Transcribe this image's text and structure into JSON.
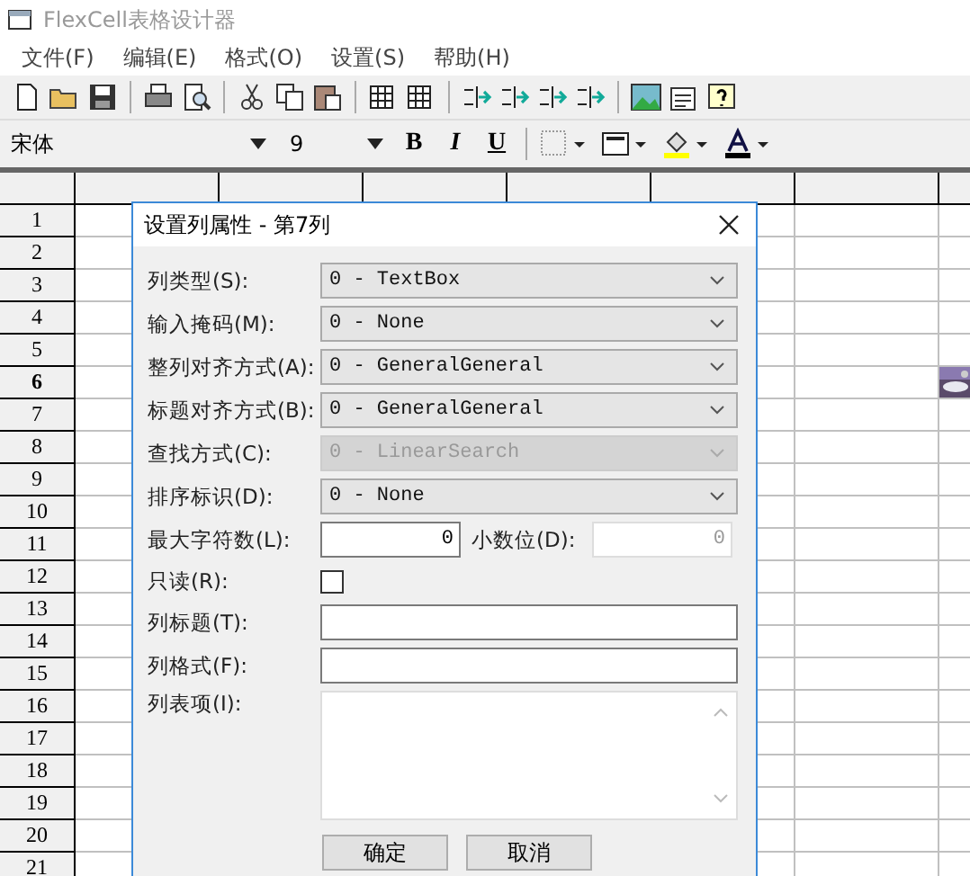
{
  "window": {
    "title": "FlexCell表格设计器"
  },
  "menu": [
    "文件(F)",
    "编辑(E)",
    "格式(O)",
    "设置(S)",
    "帮助(H)"
  ],
  "format_bar": {
    "font": "宋体",
    "size": "9",
    "bold": "B",
    "italic": "I",
    "underline": "U"
  },
  "grid": {
    "rows": [
      {
        "label": "1",
        "selected": false
      },
      {
        "label": "2",
        "selected": false
      },
      {
        "label": "3",
        "selected": false
      },
      {
        "label": "4",
        "selected": false
      },
      {
        "label": "5",
        "selected": false
      },
      {
        "label": "6",
        "selected": true
      },
      {
        "label": "7",
        "selected": false
      },
      {
        "label": "8",
        "selected": false
      },
      {
        "label": "9",
        "selected": false
      },
      {
        "label": "10",
        "selected": false
      },
      {
        "label": "11",
        "selected": false
      },
      {
        "label": "12",
        "selected": false
      },
      {
        "label": "13",
        "selected": false
      },
      {
        "label": "14",
        "selected": false
      },
      {
        "label": "15",
        "selected": false
      },
      {
        "label": "16",
        "selected": false
      },
      {
        "label": "17",
        "selected": false
      },
      {
        "label": "18",
        "selected": false
      },
      {
        "label": "19",
        "selected": false
      },
      {
        "label": "20",
        "selected": false
      },
      {
        "label": "21",
        "selected": false
      }
    ]
  },
  "dialog": {
    "title": "设置列属性 - 第7列",
    "fields": [
      {
        "kind": "select",
        "label": "列类型(S):",
        "value": "0 - TextBox",
        "disabled": false
      },
      {
        "kind": "select",
        "label": "输入掩码(M):",
        "value": "0 - None",
        "disabled": false
      },
      {
        "kind": "select",
        "label": "整列对齐方式(A):",
        "value": "0 - GeneralGeneral",
        "disabled": false
      },
      {
        "kind": "select",
        "label": "标题对齐方式(B):",
        "value": "0 - GeneralGeneral",
        "disabled": false
      },
      {
        "kind": "select",
        "label": "查找方式(C):",
        "value": "0 - LinearSearch",
        "disabled": true
      },
      {
        "kind": "select",
        "label": "排序标识(D):",
        "value": "0 - None",
        "disabled": false
      },
      {
        "kind": "pair",
        "label": "最大字符数(L):",
        "value": "0",
        "label2": "小数位(D):",
        "value2": "0"
      },
      {
        "kind": "checkbox",
        "label": "只读(R):",
        "checked": false
      },
      {
        "kind": "text",
        "label": "列标题(T):"
      },
      {
        "kind": "text",
        "label": "列格式(F):"
      },
      {
        "kind": "textarea",
        "label": "列表项(I):"
      }
    ],
    "buttons": [
      "确定",
      "取消"
    ]
  }
}
